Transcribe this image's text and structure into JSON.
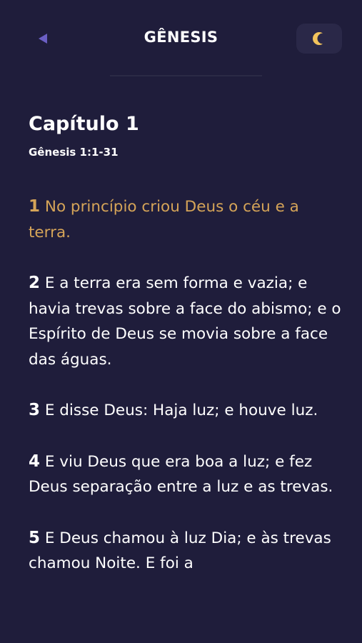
{
  "header": {
    "title": "GÊNESIS",
    "back_icon": "back-triangle-icon",
    "theme_icon": "moon-icon"
  },
  "chapter": {
    "title": "Capítulo 1",
    "reference": "Gênesis 1:1-31"
  },
  "colors": {
    "background": "#1f1d3b",
    "highlight": "#d5a458",
    "text": "#ffffff",
    "accent_icon": "#6b5fc4"
  },
  "verses": [
    {
      "num": "1",
      "text": "No princípio criou Deus o céu e a terra.",
      "highlighted": true
    },
    {
      "num": "2",
      "text": "E a terra era sem forma e vazia; e havia trevas sobre a face do abismo; e o Espírito de Deus se movia sobre a face das águas.",
      "highlighted": false
    },
    {
      "num": "3",
      "text": "E disse Deus: Haja luz; e houve luz.",
      "highlighted": false
    },
    {
      "num": "4",
      "text": "E viu Deus que era boa a luz; e fez Deus separação entre a luz e as trevas.",
      "highlighted": false
    },
    {
      "num": "5",
      "text": "E Deus chamou à luz Dia; e às trevas chamou Noite. E foi a",
      "highlighted": false
    }
  ]
}
